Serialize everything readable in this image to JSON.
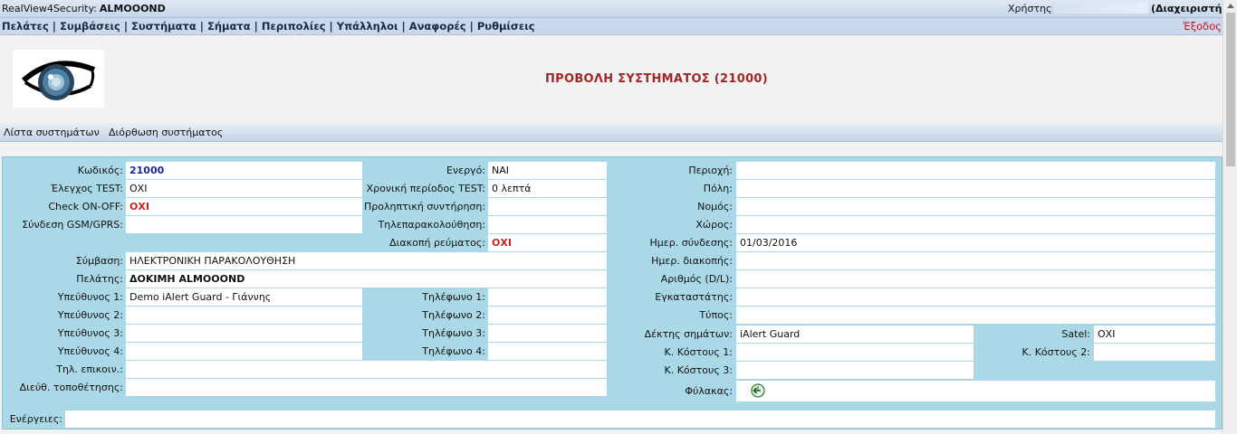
{
  "header": {
    "app_name": "RealView4Security:",
    "company": "ALMOOOND",
    "user_label": "Χρήστης:",
    "role": "(Διαχειριστής)",
    "logout": "Έξοδος"
  },
  "menu": {
    "items": [
      "Πελάτες",
      "Συμβάσεις",
      "Συστήματα",
      "Σήματα",
      "Περιπολίες",
      "Υπάλληλοι",
      "Αναφορές",
      "Ρυθμίσεις"
    ],
    "separator": "|"
  },
  "page_title": "ΠΡΟΒΟΛΗ ΣΥΣΤΗΜΑΤΟΣ (21000)",
  "subnav": {
    "list": "Λίστα συστημάτων",
    "edit": "Διόρθωση συστήματος"
  },
  "form": {
    "code": {
      "label": "Κωδικός:",
      "value": "21000"
    },
    "test_check": {
      "label": "Έλεγχος TEST:",
      "value": "ΟΧΙ"
    },
    "check_onoff": {
      "label": "Check ON-OFF:",
      "value": "ΟΧΙ"
    },
    "gsm": {
      "label": "Σύνδεση GSM/GPRS:",
      "value": ""
    },
    "active": {
      "label": "Ενεργό:",
      "value": "ΝΑΙ"
    },
    "test_period": {
      "label": "Χρονική περίοδος TEST:",
      "value": "0 λεπτά"
    },
    "maintenance": {
      "label": "Προληπτική συντήρηση:",
      "value": ""
    },
    "telemonitor": {
      "label": "Τηλεπαρακολούθηση:",
      "value": ""
    },
    "power_cut": {
      "label": "Διακοπή ρεύματος:",
      "value": "ΟΧΙ"
    },
    "contract": {
      "label": "Σύμβαση:",
      "value": "ΗΛΕΚΤΡΟΝΙΚΗ ΠΑΡΑΚΟΛΟΥΘΗΣΗ"
    },
    "customer": {
      "label": "Πελάτης:",
      "value": "ΔΟΚΙΜΗ ALMOOOND"
    },
    "resp1": {
      "label": "Υπεύθυνος 1:",
      "value": "Demo iAlert Guard - Γιάννης"
    },
    "resp2": {
      "label": "Υπεύθυνος 2:",
      "value": ""
    },
    "resp3": {
      "label": "Υπεύθυνος 3:",
      "value": ""
    },
    "resp4": {
      "label": "Υπεύθυνος 4:",
      "value": ""
    },
    "phone1": {
      "label": "Τηλέφωνο 1:",
      "value": ""
    },
    "phone2": {
      "label": "Τηλέφωνο 2:",
      "value": ""
    },
    "phone3": {
      "label": "Τηλέφωνο 3:",
      "value": ""
    },
    "phone4": {
      "label": "Τηλέφωνο 4:",
      "value": ""
    },
    "comm_phone": {
      "label": "Τηλ. επικοιν.:",
      "value": ""
    },
    "install_addr": {
      "label": "Διεύθ. τοποθέτησης:",
      "value": ""
    },
    "area": {
      "label": "Περιοχή:",
      "value": ""
    },
    "city": {
      "label": "Πόλη:",
      "value": ""
    },
    "prefecture": {
      "label": "Νομός:",
      "value": ""
    },
    "place": {
      "label": "Χώρος:",
      "value": ""
    },
    "conn_date": {
      "label": "Ημερ. σύνδεσης:",
      "value": "01/03/2016"
    },
    "disc_date": {
      "label": "Ημερ. διακοπής:",
      "value": ""
    },
    "number_dl": {
      "label": "Αριθμός (D/L):",
      "value": ""
    },
    "installer": {
      "label": "Εγκαταστάτης:",
      "value": ""
    },
    "type": {
      "label": "Τύπος:",
      "value": ""
    },
    "receiver": {
      "label": "Δέκτης σημάτων:",
      "value": "iAlert Guard"
    },
    "satel": {
      "label": "Satel:",
      "value": "ΟΧΙ"
    },
    "cost1": {
      "label": "Κ. Κόστους 1:",
      "value": ""
    },
    "cost2": {
      "label": "Κ. Κόστους 2:",
      "value": ""
    },
    "cost3": {
      "label": "Κ. Κόστους 3:",
      "value": ""
    },
    "guard": {
      "label": "Φύλακας:"
    },
    "actions": {
      "label": "Ενέργειες:",
      "value": ""
    }
  }
}
